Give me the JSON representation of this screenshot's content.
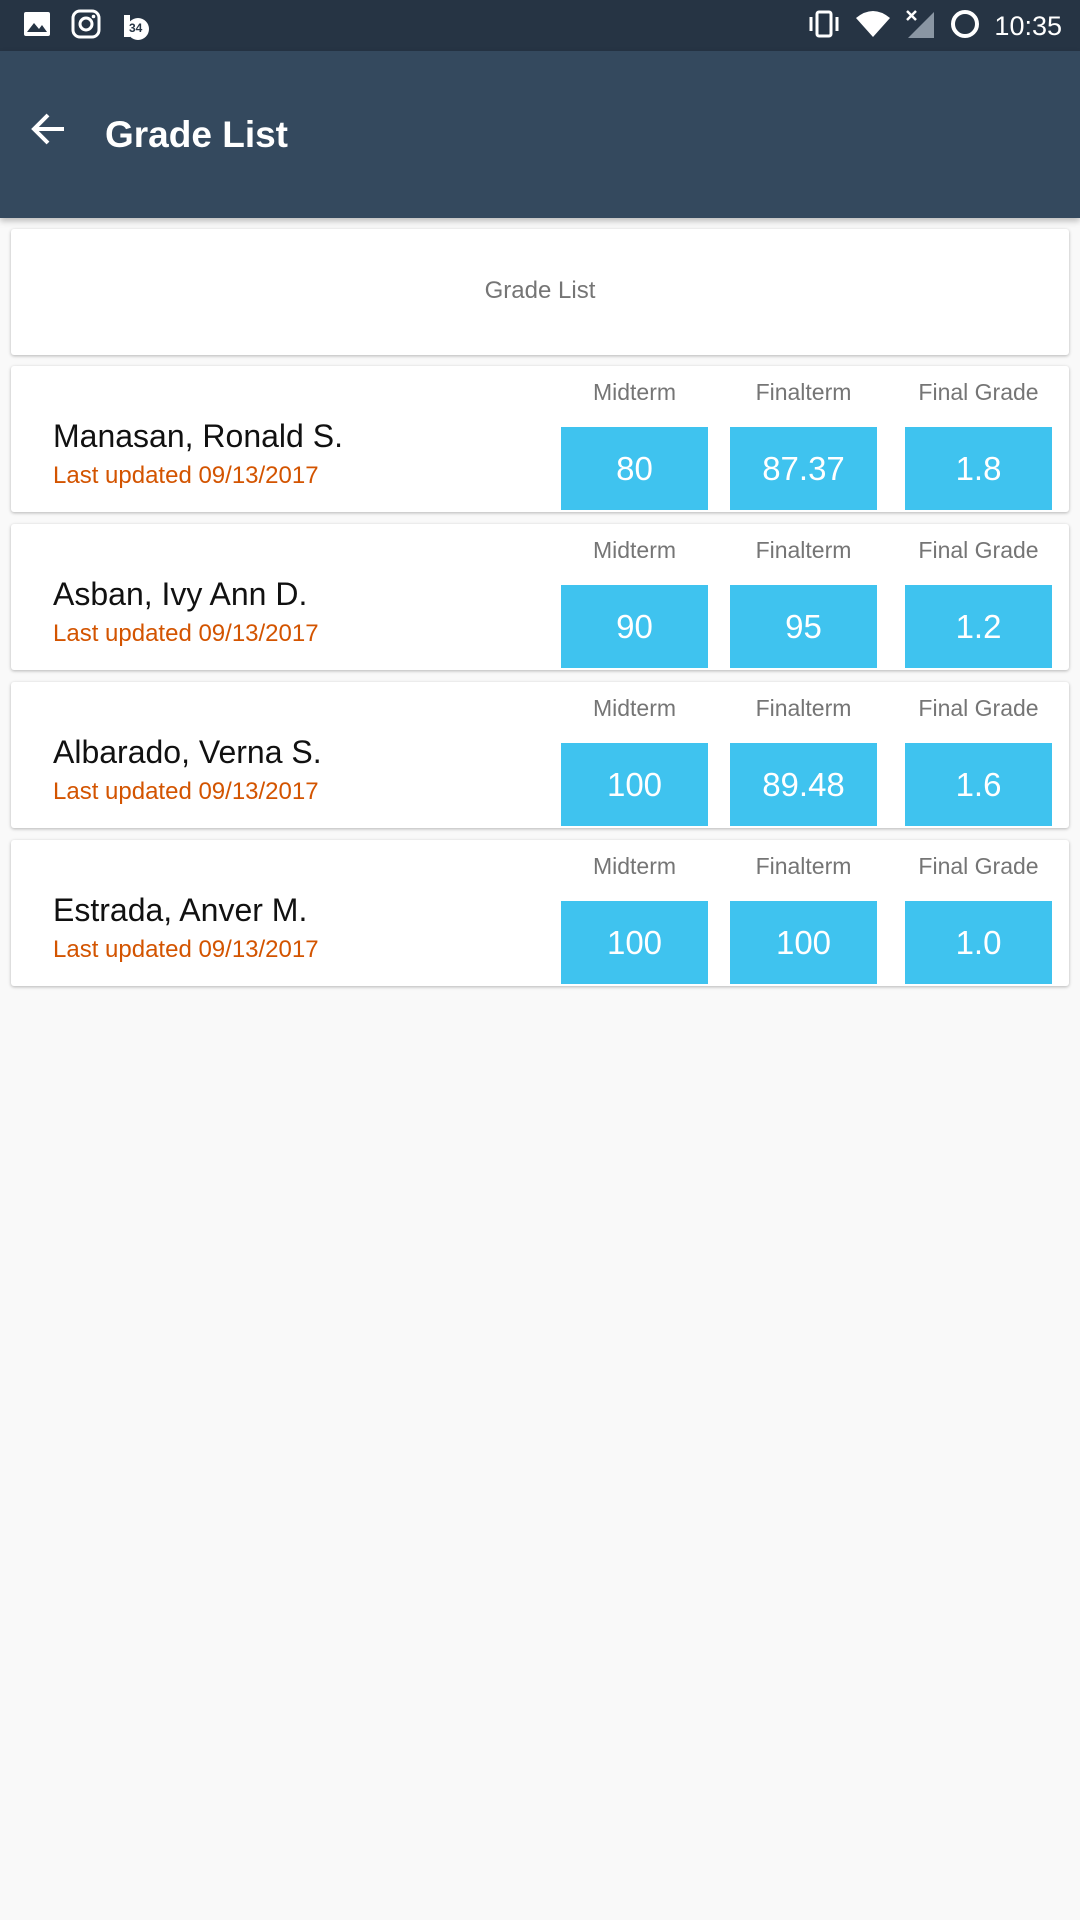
{
  "status_bar": {
    "time": "10:35",
    "notification_badge": "34",
    "icons": [
      "image-icon",
      "instagram-icon",
      "notification-badge-icon",
      "vibrate-icon",
      "wifi-icon",
      "no-signal-icon",
      "battery-charging-icon"
    ]
  },
  "app_bar": {
    "title": "Grade List"
  },
  "list_header": {
    "label": "Grade List"
  },
  "columns": {
    "midterm": "Midterm",
    "finalterm": "Finalterm",
    "final_grade": "Final Grade"
  },
  "students": [
    {
      "name": "Manasan, Ronald S.",
      "updated": "Last updated 09/13/2017",
      "midterm": "80",
      "finalterm": "87.37",
      "final_grade": "1.8"
    },
    {
      "name": "Asban, Ivy Ann D.",
      "updated": "Last updated 09/13/2017",
      "midterm": "90",
      "finalterm": "95",
      "final_grade": "1.2"
    },
    {
      "name": "Albarado, Verna S.",
      "updated": "Last updated 09/13/2017",
      "midterm": "100",
      "finalterm": "89.48",
      "final_grade": "1.6"
    },
    {
      "name": "Estrada, Anver M.",
      "updated": "Last updated 09/13/2017",
      "midterm": "100",
      "finalterm": "100",
      "final_grade": "1.0"
    }
  ],
  "colors": {
    "status_bar": "#263444",
    "app_bar": "#34495e",
    "grade_box": "#3fc3ef",
    "updated_text": "#d35400",
    "background": "#f9f9f9"
  }
}
